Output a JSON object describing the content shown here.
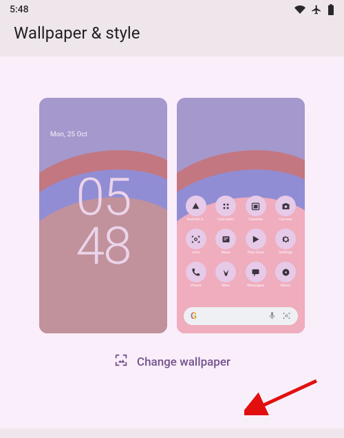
{
  "status": {
    "time": "5:48",
    "icons": [
      "wifi",
      "airplane",
      "battery"
    ]
  },
  "page_title": "Wallpaper & style",
  "lock_preview": {
    "date": "Mon, 25 Oct",
    "clock_top": "05",
    "clock_bottom": "48"
  },
  "home_preview": {
    "apps": [
      {
        "name": "Android A..",
        "icon": "android"
      },
      {
        "name": "Calculator",
        "icon": "grid4"
      },
      {
        "name": "Calendar",
        "icon": "calendar"
      },
      {
        "name": "Camera",
        "icon": "camera"
      },
      {
        "name": "Lens",
        "icon": "lens"
      },
      {
        "name": "News",
        "icon": "news"
      },
      {
        "name": "Play Store",
        "icon": "play"
      },
      {
        "name": "Settings",
        "icon": "gear"
      },
      {
        "name": "Phone",
        "icon": "phone"
      },
      {
        "name": "Wear",
        "icon": "wear"
      },
      {
        "name": "Messages",
        "icon": "message"
      },
      {
        "name": "Music",
        "icon": "disc"
      }
    ],
    "search": {
      "logo": "G"
    }
  },
  "change_wallpaper": {
    "label": "Change wallpaper"
  },
  "colors": {
    "accent": "#73528c"
  }
}
